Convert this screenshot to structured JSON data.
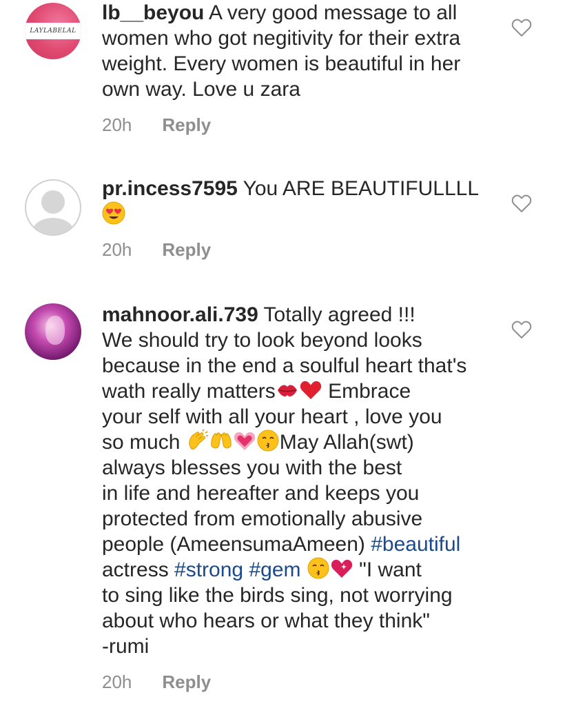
{
  "comments": [
    {
      "username": "lb__beyou",
      "text": " A very good  message to all women who got negitivity for their extra weight. Every women is beautiful in her own way. Love u zara",
      "time": "20h",
      "reply_label": "Reply",
      "avatar": {
        "type": "logo",
        "logo_text": "LAYLABELAL"
      }
    },
    {
      "username": "pr.incess7595",
      "text": " You ARE BEAUTIFULLLL",
      "emoji_after": "heart-eyes-emoji",
      "time": "20h",
      "reply_label": "Reply",
      "avatar": {
        "type": "default-profile"
      }
    },
    {
      "username": "mahnoor.ali.739",
      "line1": " Totally agreed !!!",
      "line2": "We should try to look beyond looks",
      "line3": "because in the end a soulful heart that's",
      "line4": "wath really matters",
      "line4b": " Embrace",
      "line5": "your self with  all your heart , love you",
      "line6a": "so much ",
      "line6b": "May Allah(swt)",
      "line7": "always blesses you with the best",
      "line8": "in life and hereafter and keeps you",
      "line9": "protected from emotionally abusive",
      "line10a": "people (AmeensumaAmeen) ",
      "hashtag1": "#beautiful",
      "line11a": "actress  ",
      "hashtag2": "#strong",
      "hashtag3": "#gem",
      "line11b": " \"I want",
      "line12": "to sing like the birds sing, not worrying",
      "line13": "about who hears or what they think\"",
      "line14": "-rumi",
      "time": "20h",
      "reply_label": "Reply",
      "avatar": {
        "type": "photo"
      }
    }
  ],
  "colors": {
    "text": "#262626",
    "meta": "#8e8e8e",
    "hashtag": "#1a4a8a",
    "background": "#ffffff"
  }
}
